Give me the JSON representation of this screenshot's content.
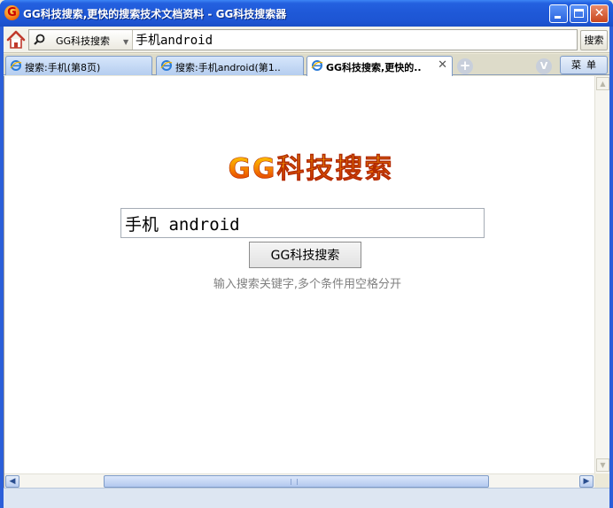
{
  "window": {
    "title": "GG科技搜索,更快的搜索技术文档资料 - GG科技搜索器",
    "app_icon_letter": "G"
  },
  "toolbar": {
    "engine_name": "GG科技搜索",
    "address_value": "手机android",
    "search_button_label": "搜索"
  },
  "tabs": [
    {
      "label": "搜索:手机(第8页)",
      "active": false
    },
    {
      "label": "搜索:手机android(第1..",
      "active": false
    },
    {
      "label": "GG科技搜索,更快的..",
      "active": true
    }
  ],
  "tabbar": {
    "new_tab_label": "+",
    "v_label": "V",
    "menu_label": "菜单"
  },
  "page": {
    "logo_text": "GG科技搜索",
    "query_value": "手机 android",
    "search_button_label": "GG科技搜索",
    "hint": "输入搜索关键字,多个条件用空格分开"
  },
  "colors": {
    "titlebar": "#1f59d8",
    "logo_top": "#ffd200",
    "logo_bottom": "#d62000"
  }
}
